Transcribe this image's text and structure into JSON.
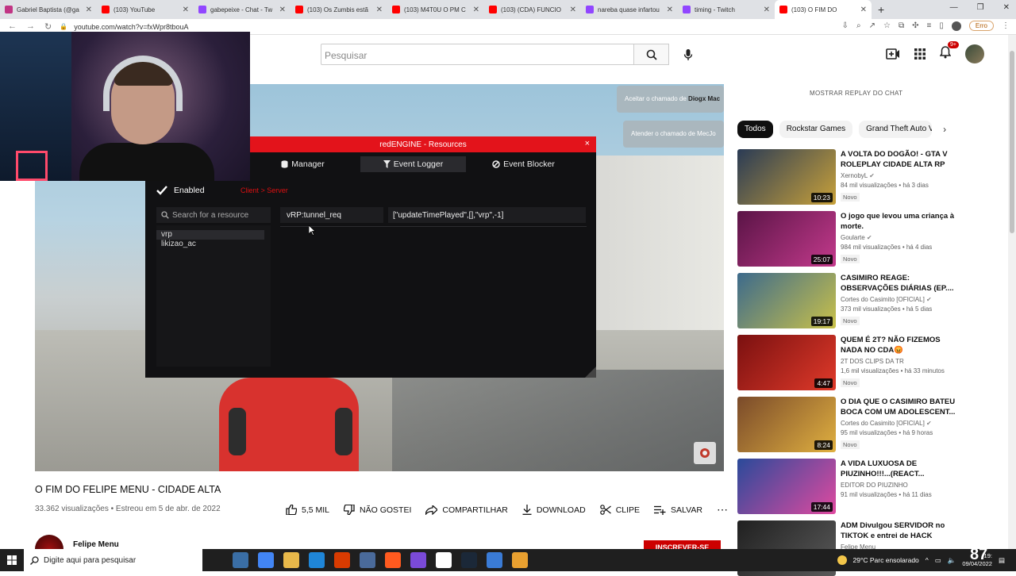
{
  "browser": {
    "tabs": [
      {
        "title": "Gabriel Baptista (@ga",
        "color": "#c13584",
        "active": false
      },
      {
        "title": "(103) YouTube",
        "color": "#ff0000",
        "active": false
      },
      {
        "title": "gabepeixe - Chat - Tw",
        "color": "#9146ff",
        "active": false
      },
      {
        "title": "(103) Os Zumbis estã",
        "color": "#ff0000",
        "active": false
      },
      {
        "title": "(103) M4T0U O PM C",
        "color": "#ff0000",
        "active": false
      },
      {
        "title": "(103) (CDA) FUNCIO",
        "color": "#ff0000",
        "active": false
      },
      {
        "title": "nareba quase infartou",
        "color": "#9146ff",
        "active": false
      },
      {
        "title": "timing - Twitch",
        "color": "#9146ff",
        "active": false
      },
      {
        "title": "(103) O FIM DO",
        "color": "#ff0000",
        "active": true
      }
    ],
    "new_tab": "+",
    "url": "youtube.com/watch?v=fxWpr8tbouA",
    "error_label": "Erro"
  },
  "yt": {
    "search_placeholder": "Pesquisar",
    "notif_count": "9+"
  },
  "game": {
    "notices": [
      {
        "prefix": "Aceitar o chamado de ",
        "name": "Diogx Mac"
      },
      {
        "prefix": "Atender o chamado de MecJo",
        "name": ""
      }
    ]
  },
  "redengine": {
    "title": "redENGINE - Resources",
    "close": "×",
    "nav": [
      {
        "icon": "database-icon",
        "label": "Manager",
        "active": false
      },
      {
        "icon": "filter-icon",
        "label": "Event Logger",
        "active": true
      },
      {
        "icon": "block-icon",
        "label": "Event Blocker",
        "active": false
      }
    ],
    "enabled_label": "Enabled",
    "direction_label": "Client > Server",
    "search_placeholder": "Search for a resource",
    "resources": [
      "vrp",
      "likizao_ac"
    ],
    "event_name": "vRP:tunnel_req",
    "event_args": "[\"updateTimePlayed\",[],\"vrp\",-1]"
  },
  "video": {
    "title": "O FIM DO FELIPE MENU - CIDADE ALTA",
    "meta": "33.362 visualizações • Estreou em 5 de abr. de 2022",
    "actions": {
      "like": "5,5 MIL",
      "dislike": "NÃO GOSTEI",
      "share": "COMPARTILHAR",
      "download": "DOWNLOAD",
      "clip": "CLIPE",
      "save": "SALVAR",
      "more": "⋯"
    },
    "channel": "Felipe Menu",
    "subscribe": "INSCREVER-SE"
  },
  "sidebar": {
    "replay": "MOSTRAR REPLAY DO CHAT",
    "chips": [
      "Todos",
      "Rockstar Games",
      "Grand Theft Auto V"
    ],
    "recommendations": [
      {
        "title": "A VOLTA DO DOGÃO! - GTA V ROLEPLAY CIDADE ALTA RP",
        "channel": "XernobyL",
        "verified": true,
        "views": "84 mil visualizações • há 3 dias",
        "badge": "Novo",
        "duration": "10:23",
        "thumb": [
          "#2a3b55",
          "#c8a13a"
        ]
      },
      {
        "title": "O jogo que levou uma criança à morte.",
        "channel": "Goularte",
        "verified": true,
        "views": "984 mil visualizações • há 4 dias",
        "badge": "Novo",
        "duration": "25:07",
        "thumb": [
          "#5a1446",
          "#c33a8c"
        ]
      },
      {
        "title": "CASIMIRO REAGE: OBSERVAÇÕES DIÁRIAS (EP....",
        "channel": "Cortes do Casimito [OFICIAL]",
        "verified": true,
        "views": "373 mil visualizações • há 5 dias",
        "badge": "Novo",
        "duration": "19:17",
        "thumb": [
          "#3c6a8c",
          "#c9c14a"
        ]
      },
      {
        "title": "QUEM É 2T? NÃO FIZEMOS NADA NO CDA😡",
        "channel": "2T DOS CLIPS DA TR",
        "verified": false,
        "views": "1,6 mil visualizações • há 33 minutos",
        "badge": "Novo",
        "duration": "4:47",
        "thumb": [
          "#7a1010",
          "#e03a2a"
        ]
      },
      {
        "title": "O DIA QUE O CASIMIRO BATEU BOCA COM UM ADOLESCENT...",
        "channel": "Cortes do Casimito [OFICIAL]",
        "verified": true,
        "views": "95 mil visualizações • há 9 horas",
        "badge": "Novo",
        "duration": "8:24",
        "thumb": [
          "#7a4a2a",
          "#e0b040"
        ]
      },
      {
        "title": "A VIDA LUXUOSA DE PIUZINHO!!!...(REACT...",
        "channel": "EDITOR DO PIUZINHO",
        "verified": false,
        "views": "91 mil visualizações • há 11 dias",
        "badge": "",
        "duration": "17:44",
        "thumb": [
          "#2a4a9a",
          "#e04aa0"
        ]
      },
      {
        "title": "ADM Divulgou SERVIDOR no TIKTOK e entrei de HACK",
        "channel": "Felipe Menu",
        "verified": false,
        "views": "",
        "badge": "",
        "duration": "",
        "thumb": [
          "#202020",
          "#5a5a5a"
        ]
      }
    ]
  },
  "taskbar": {
    "search_placeholder": "Digite aqui para pesquisar",
    "weather": "29°C  Parc ensolarado",
    "time": "19:",
    "date": "09/04/2022",
    "overlay_number": "87",
    "apps": [
      "#3a6ea5",
      "#4285f4",
      "#e8b84a",
      "#1f86d8",
      "#d83b01",
      "#4a6a9a",
      "#ff5a1f",
      "#7a4ad8",
      "#ffffff",
      "#1b2838",
      "#3a7bd5",
      "#e8a030"
    ]
  }
}
